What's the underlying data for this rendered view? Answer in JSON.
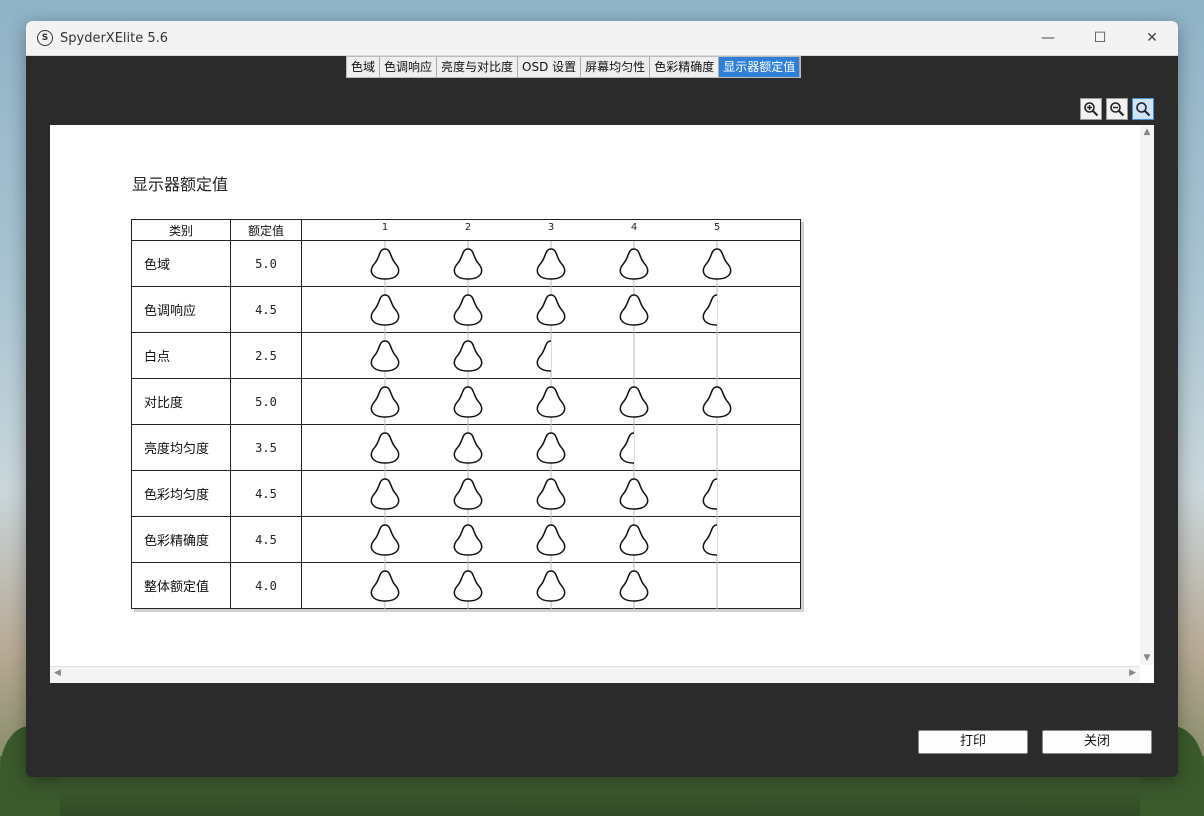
{
  "window": {
    "title": "SpyderXElite 5.6",
    "minimize_glyph": "—",
    "maximize_glyph": "☐",
    "close_glyph": "✕"
  },
  "tabs": [
    {
      "label": "色域",
      "active": false
    },
    {
      "label": "色调响应",
      "active": false
    },
    {
      "label": "亮度与对比度",
      "active": false
    },
    {
      "label": "OSD 设置",
      "active": false
    },
    {
      "label": "屏幕均匀性",
      "active": false
    },
    {
      "label": "色彩精确度",
      "active": false
    },
    {
      "label": "显示器额定值",
      "active": true
    }
  ],
  "zoom_tools": [
    {
      "name": "zoom-in-icon",
      "active": false
    },
    {
      "name": "zoom-out-icon",
      "active": false
    },
    {
      "name": "zoom-fit-icon",
      "active": true
    }
  ],
  "report": {
    "title": "显示器额定值",
    "headers": {
      "category": "类别",
      "rating": "额定值"
    },
    "scale_ticks": [
      "1",
      "2",
      "3",
      "4",
      "5"
    ],
    "rows": [
      {
        "category": "色域",
        "rating_text": "5.0",
        "rating": 5.0
      },
      {
        "category": "色调响应",
        "rating_text": "4.5",
        "rating": 4.5
      },
      {
        "category": "白点",
        "rating_text": "2.5",
        "rating": 2.5
      },
      {
        "category": "对比度",
        "rating_text": "5.0",
        "rating": 5.0
      },
      {
        "category": "亮度均匀度",
        "rating_text": "3.5",
        "rating": 3.5
      },
      {
        "category": "色彩均匀度",
        "rating_text": "4.5",
        "rating": 4.5
      },
      {
        "category": "色彩精确度",
        "rating_text": "4.5",
        "rating": 4.5
      },
      {
        "category": "整体额定值",
        "rating_text": "4.0",
        "rating": 4.0
      }
    ]
  },
  "buttons": {
    "print": "打印",
    "close": "关闭"
  }
}
